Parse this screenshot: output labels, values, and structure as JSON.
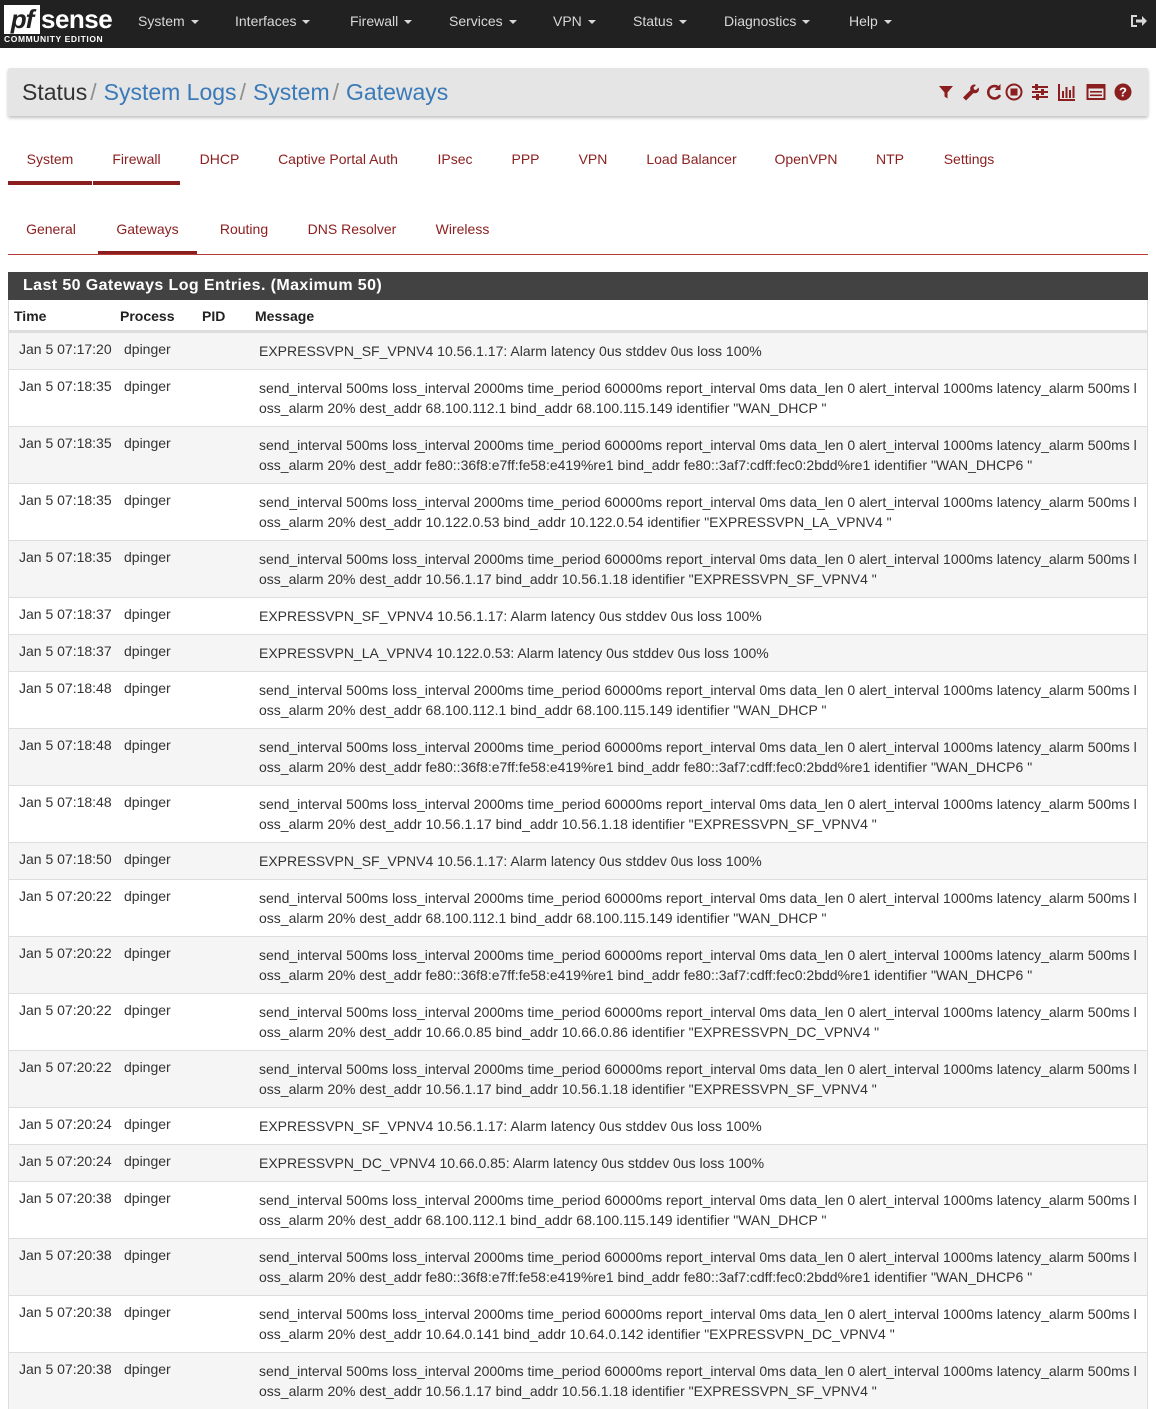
{
  "brand": {
    "logo_main": "pf",
    "logo_suffix": "sense",
    "edition": "COMMUNITY EDITION"
  },
  "nav": {
    "items": [
      {
        "label": "System"
      },
      {
        "label": "Interfaces"
      },
      {
        "label": "Firewall"
      },
      {
        "label": "Services"
      },
      {
        "label": "VPN"
      },
      {
        "label": "Status"
      },
      {
        "label": "Diagnostics"
      },
      {
        "label": "Help"
      }
    ],
    "logout_icon": "sign-out-icon"
  },
  "breadcrumb": {
    "root": "Status",
    "level1": "System Logs",
    "level2": "System",
    "level3": "Gateways",
    "separator": "/"
  },
  "header_icons": [
    "filter-icon",
    "wrench-icon",
    "refresh-icon",
    "stop-icon",
    "sliders-icon",
    "bar-chart-icon",
    "table-icon",
    "help-icon"
  ],
  "tabs_primary": [
    {
      "label": "System",
      "active": true
    },
    {
      "label": "Firewall",
      "active": true
    },
    {
      "label": "DHCP"
    },
    {
      "label": "Captive Portal Auth"
    },
    {
      "label": "IPsec"
    },
    {
      "label": "PPP"
    },
    {
      "label": "VPN"
    },
    {
      "label": "Load Balancer"
    },
    {
      "label": "OpenVPN"
    },
    {
      "label": "NTP"
    },
    {
      "label": "Settings"
    }
  ],
  "tabs_secondary": [
    {
      "label": "General"
    },
    {
      "label": "Gateways",
      "active": true
    },
    {
      "label": "Routing"
    },
    {
      "label": "DNS Resolver"
    },
    {
      "label": "Wireless"
    }
  ],
  "panel": {
    "title": "Last 50 Gateways Log Entries. (Maximum 50)",
    "columns": {
      "time": "Time",
      "process": "Process",
      "pid": "PID",
      "message": "Message"
    }
  },
  "colors": {
    "accent": "#8b1e1e",
    "navbar": "#212121",
    "panel_header": "#424242",
    "link": "#3a7ab8"
  },
  "log_rows": [
    {
      "time": "Jan 5 07:17:20",
      "process": "dpinger",
      "pid": "",
      "message": "EXPRESSVPN_SF_VPNV4 10.56.1.17: Alarm latency 0us stddev 0us loss 100%"
    },
    {
      "time": "Jan 5 07:18:35",
      "process": "dpinger",
      "pid": "",
      "message": "send_interval 500ms loss_interval 2000ms time_period 60000ms report_interval 0ms data_len 0 alert_interval 1000ms latency_alarm 500ms loss_alarm 20% dest_addr 68.100.112.1 bind_addr 68.100.115.149 identifier \"WAN_DHCP \""
    },
    {
      "time": "Jan 5 07:18:35",
      "process": "dpinger",
      "pid": "",
      "message": "send_interval 500ms loss_interval 2000ms time_period 60000ms report_interval 0ms data_len 0 alert_interval 1000ms latency_alarm 500ms loss_alarm 20% dest_addr fe80::36f8:e7ff:fe58:e419%re1 bind_addr fe80::3af7:cdff:fec0:2bdd%re1 identifier \"WAN_DHCP6 \""
    },
    {
      "time": "Jan 5 07:18:35",
      "process": "dpinger",
      "pid": "",
      "message": "send_interval 500ms loss_interval 2000ms time_period 60000ms report_interval 0ms data_len 0 alert_interval 1000ms latency_alarm 500ms loss_alarm 20% dest_addr 10.122.0.53 bind_addr 10.122.0.54 identifier \"EXPRESSVPN_LA_VPNV4 \""
    },
    {
      "time": "Jan 5 07:18:35",
      "process": "dpinger",
      "pid": "",
      "message": "send_interval 500ms loss_interval 2000ms time_period 60000ms report_interval 0ms data_len 0 alert_interval 1000ms latency_alarm 500ms loss_alarm 20% dest_addr 10.56.1.17 bind_addr 10.56.1.18 identifier \"EXPRESSVPN_SF_VPNV4 \""
    },
    {
      "time": "Jan 5 07:18:37",
      "process": "dpinger",
      "pid": "",
      "message": "EXPRESSVPN_SF_VPNV4 10.56.1.17: Alarm latency 0us stddev 0us loss 100%"
    },
    {
      "time": "Jan 5 07:18:37",
      "process": "dpinger",
      "pid": "",
      "message": "EXPRESSVPN_LA_VPNV4 10.122.0.53: Alarm latency 0us stddev 0us loss 100%"
    },
    {
      "time": "Jan 5 07:18:48",
      "process": "dpinger",
      "pid": "",
      "message": "send_interval 500ms loss_interval 2000ms time_period 60000ms report_interval 0ms data_len 0 alert_interval 1000ms latency_alarm 500ms loss_alarm 20% dest_addr 68.100.112.1 bind_addr 68.100.115.149 identifier \"WAN_DHCP \""
    },
    {
      "time": "Jan 5 07:18:48",
      "process": "dpinger",
      "pid": "",
      "message": "send_interval 500ms loss_interval 2000ms time_period 60000ms report_interval 0ms data_len 0 alert_interval 1000ms latency_alarm 500ms loss_alarm 20% dest_addr fe80::36f8:e7ff:fe58:e419%re1 bind_addr fe80::3af7:cdff:fec0:2bdd%re1 identifier \"WAN_DHCP6 \""
    },
    {
      "time": "Jan 5 07:18:48",
      "process": "dpinger",
      "pid": "",
      "message": "send_interval 500ms loss_interval 2000ms time_period 60000ms report_interval 0ms data_len 0 alert_interval 1000ms latency_alarm 500ms loss_alarm 20% dest_addr 10.56.1.17 bind_addr 10.56.1.18 identifier \"EXPRESSVPN_SF_VPNV4 \""
    },
    {
      "time": "Jan 5 07:18:50",
      "process": "dpinger",
      "pid": "",
      "message": "EXPRESSVPN_SF_VPNV4 10.56.1.17: Alarm latency 0us stddev 0us loss 100%"
    },
    {
      "time": "Jan 5 07:20:22",
      "process": "dpinger",
      "pid": "",
      "message": "send_interval 500ms loss_interval 2000ms time_period 60000ms report_interval 0ms data_len 0 alert_interval 1000ms latency_alarm 500ms loss_alarm 20% dest_addr 68.100.112.1 bind_addr 68.100.115.149 identifier \"WAN_DHCP \""
    },
    {
      "time": "Jan 5 07:20:22",
      "process": "dpinger",
      "pid": "",
      "message": "send_interval 500ms loss_interval 2000ms time_period 60000ms report_interval 0ms data_len 0 alert_interval 1000ms latency_alarm 500ms loss_alarm 20% dest_addr fe80::36f8:e7ff:fe58:e419%re1 bind_addr fe80::3af7:cdff:fec0:2bdd%re1 identifier \"WAN_DHCP6 \""
    },
    {
      "time": "Jan 5 07:20:22",
      "process": "dpinger",
      "pid": "",
      "message": "send_interval 500ms loss_interval 2000ms time_period 60000ms report_interval 0ms data_len 0 alert_interval 1000ms latency_alarm 500ms loss_alarm 20% dest_addr 10.66.0.85 bind_addr 10.66.0.86 identifier \"EXPRESSVPN_DC_VPNV4 \""
    },
    {
      "time": "Jan 5 07:20:22",
      "process": "dpinger",
      "pid": "",
      "message": "send_interval 500ms loss_interval 2000ms time_period 60000ms report_interval 0ms data_len 0 alert_interval 1000ms latency_alarm 500ms loss_alarm 20% dest_addr 10.56.1.17 bind_addr 10.56.1.18 identifier \"EXPRESSVPN_SF_VPNV4 \""
    },
    {
      "time": "Jan 5 07:20:24",
      "process": "dpinger",
      "pid": "",
      "message": "EXPRESSVPN_SF_VPNV4 10.56.1.17: Alarm latency 0us stddev 0us loss 100%"
    },
    {
      "time": "Jan 5 07:20:24",
      "process": "dpinger",
      "pid": "",
      "message": "EXPRESSVPN_DC_VPNV4 10.66.0.85: Alarm latency 0us stddev 0us loss 100%"
    },
    {
      "time": "Jan 5 07:20:38",
      "process": "dpinger",
      "pid": "",
      "message": "send_interval 500ms loss_interval 2000ms time_period 60000ms report_interval 0ms data_len 0 alert_interval 1000ms latency_alarm 500ms loss_alarm 20% dest_addr 68.100.112.1 bind_addr 68.100.115.149 identifier \"WAN_DHCP \""
    },
    {
      "time": "Jan 5 07:20:38",
      "process": "dpinger",
      "pid": "",
      "message": "send_interval 500ms loss_interval 2000ms time_period 60000ms report_interval 0ms data_len 0 alert_interval 1000ms latency_alarm 500ms loss_alarm 20% dest_addr fe80::36f8:e7ff:fe58:e419%re1 bind_addr fe80::3af7:cdff:fec0:2bdd%re1 identifier \"WAN_DHCP6 \""
    },
    {
      "time": "Jan 5 07:20:38",
      "process": "dpinger",
      "pid": "",
      "message": "send_interval 500ms loss_interval 2000ms time_period 60000ms report_interval 0ms data_len 0 alert_interval 1000ms latency_alarm 500ms loss_alarm 20% dest_addr 10.64.0.141 bind_addr 10.64.0.142 identifier \"EXPRESSVPN_DC_VPNV4 \""
    },
    {
      "time": "Jan 5 07:20:38",
      "process": "dpinger",
      "pid": "",
      "message": "send_interval 500ms loss_interval 2000ms time_period 60000ms report_interval 0ms data_len 0 alert_interval 1000ms latency_alarm 500ms loss_alarm 20% dest_addr 10.56.1.17 bind_addr 10.56.1.18 identifier \"EXPRESSVPN_SF_VPNV4 \""
    }
  ]
}
